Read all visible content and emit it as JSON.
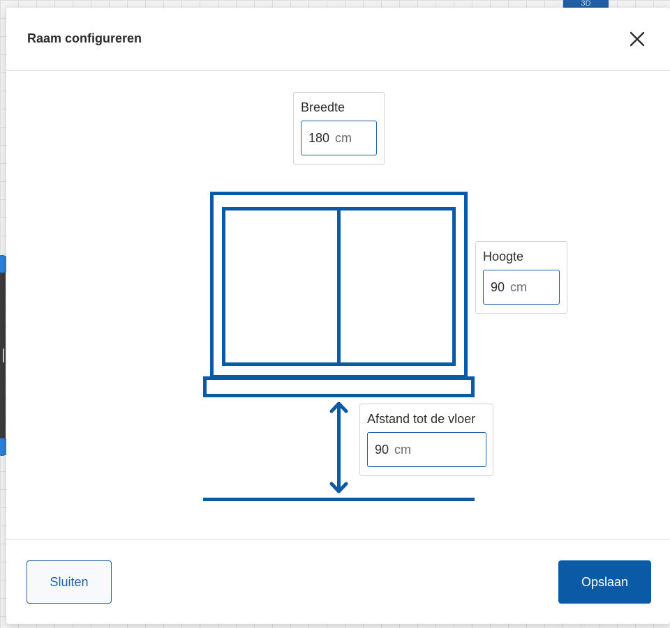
{
  "background": {
    "view_tab_label": "3D"
  },
  "dialog": {
    "title": "Raam configureren",
    "close_icon": "close-icon"
  },
  "fields": {
    "width": {
      "label": "Breedte",
      "value": "180",
      "unit": "cm"
    },
    "height": {
      "label": "Hoogte",
      "value": "90",
      "unit": "cm"
    },
    "floor_distance": {
      "label": "Afstand tot de vloer",
      "value": "90",
      "unit": "cm"
    }
  },
  "footer": {
    "close_label": "Sluiten",
    "save_label": "Opslaan"
  },
  "colors": {
    "accent": "#0b5aa6",
    "diagram_stroke": "#0b5aa6"
  }
}
